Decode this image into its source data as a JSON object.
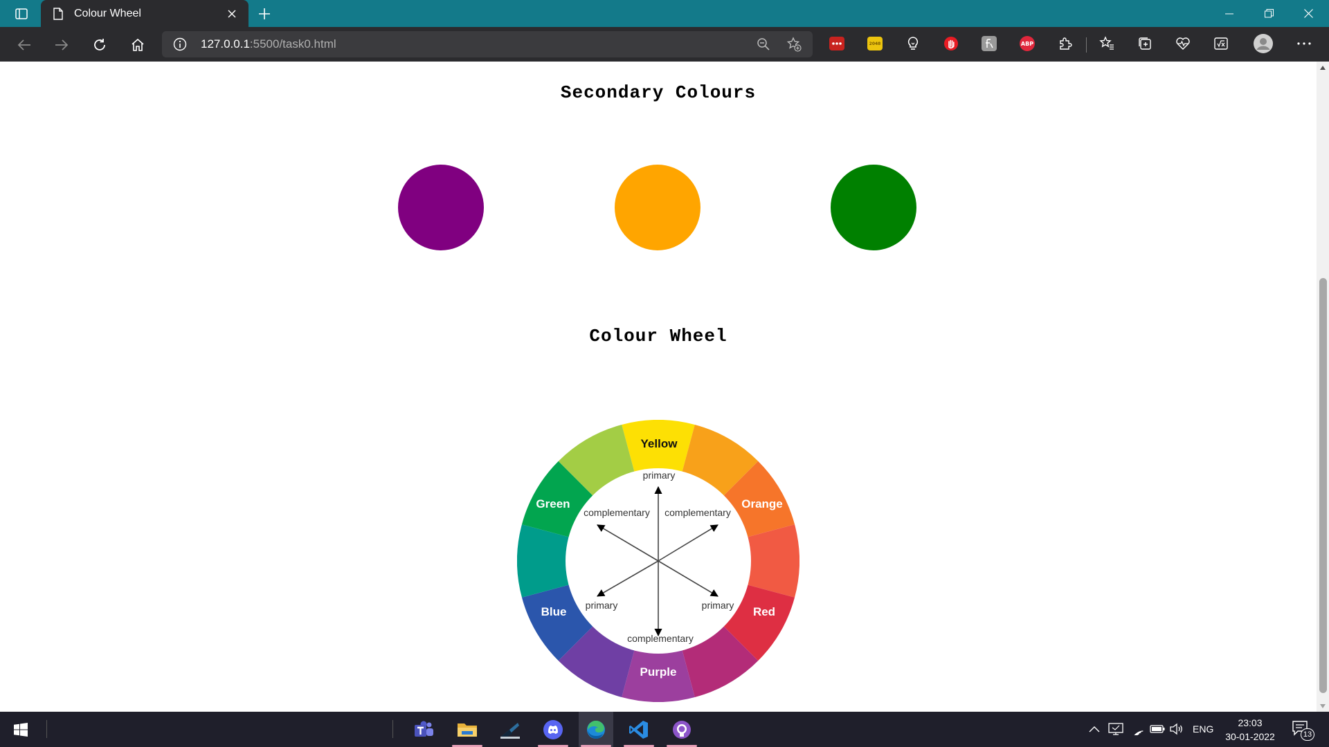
{
  "browser": {
    "tab_title": "Colour Wheel",
    "url_host": "127.0.0.1",
    "url_rest": ":5500/task0.html",
    "extensions": [
      {
        "name": "lastpass-icon",
        "color": "#d32d27",
        "label": "•••"
      },
      {
        "name": "tt2048-icon",
        "color": "#e8c01a",
        "label": "2048"
      },
      {
        "name": "lightbulb-icon",
        "color": "",
        "label": ""
      },
      {
        "name": "hand-icon",
        "color": "#e81c24",
        "label": ""
      },
      {
        "name": "grammar-icon",
        "color": "#999999",
        "label": "ft"
      },
      {
        "name": "adblock-plus-icon",
        "color": "#e0273c",
        "label": "ABP"
      }
    ]
  },
  "page": {
    "secondary_heading": "Secondary Colours",
    "wheel_heading": "Colour Wheel",
    "secondary_colours": [
      {
        "name": "purple",
        "color": "#800080"
      },
      {
        "name": "orange",
        "color": "#ffa500"
      },
      {
        "name": "green",
        "color": "#008000"
      }
    ],
    "wheel": {
      "segment_colors": [
        "#fde004",
        "#f8a11a",
        "#f6752a",
        "#f15a43",
        "#de2f43",
        "#b32c78",
        "#9c3f9e",
        "#6f3fa4",
        "#2b56ac",
        "#009c8b",
        "#02a54f",
        "#a3cd45"
      ],
      "labels": {
        "yellow": "Yellow",
        "orange": "Orange",
        "red": "Red",
        "purple": "Purple",
        "blue": "Blue",
        "green": "Green"
      },
      "inner": {
        "primary": "primary",
        "complementary": "complementary"
      }
    }
  },
  "taskbar": {
    "apps": [
      "teams-icon",
      "file-explorer-icon",
      "app-icon",
      "discord-icon",
      "edge-icon",
      "vscode-icon",
      "github-desktop-icon"
    ],
    "language": "ENG",
    "time": "23:03",
    "date": "30-01-2022",
    "notification_count": "13"
  }
}
